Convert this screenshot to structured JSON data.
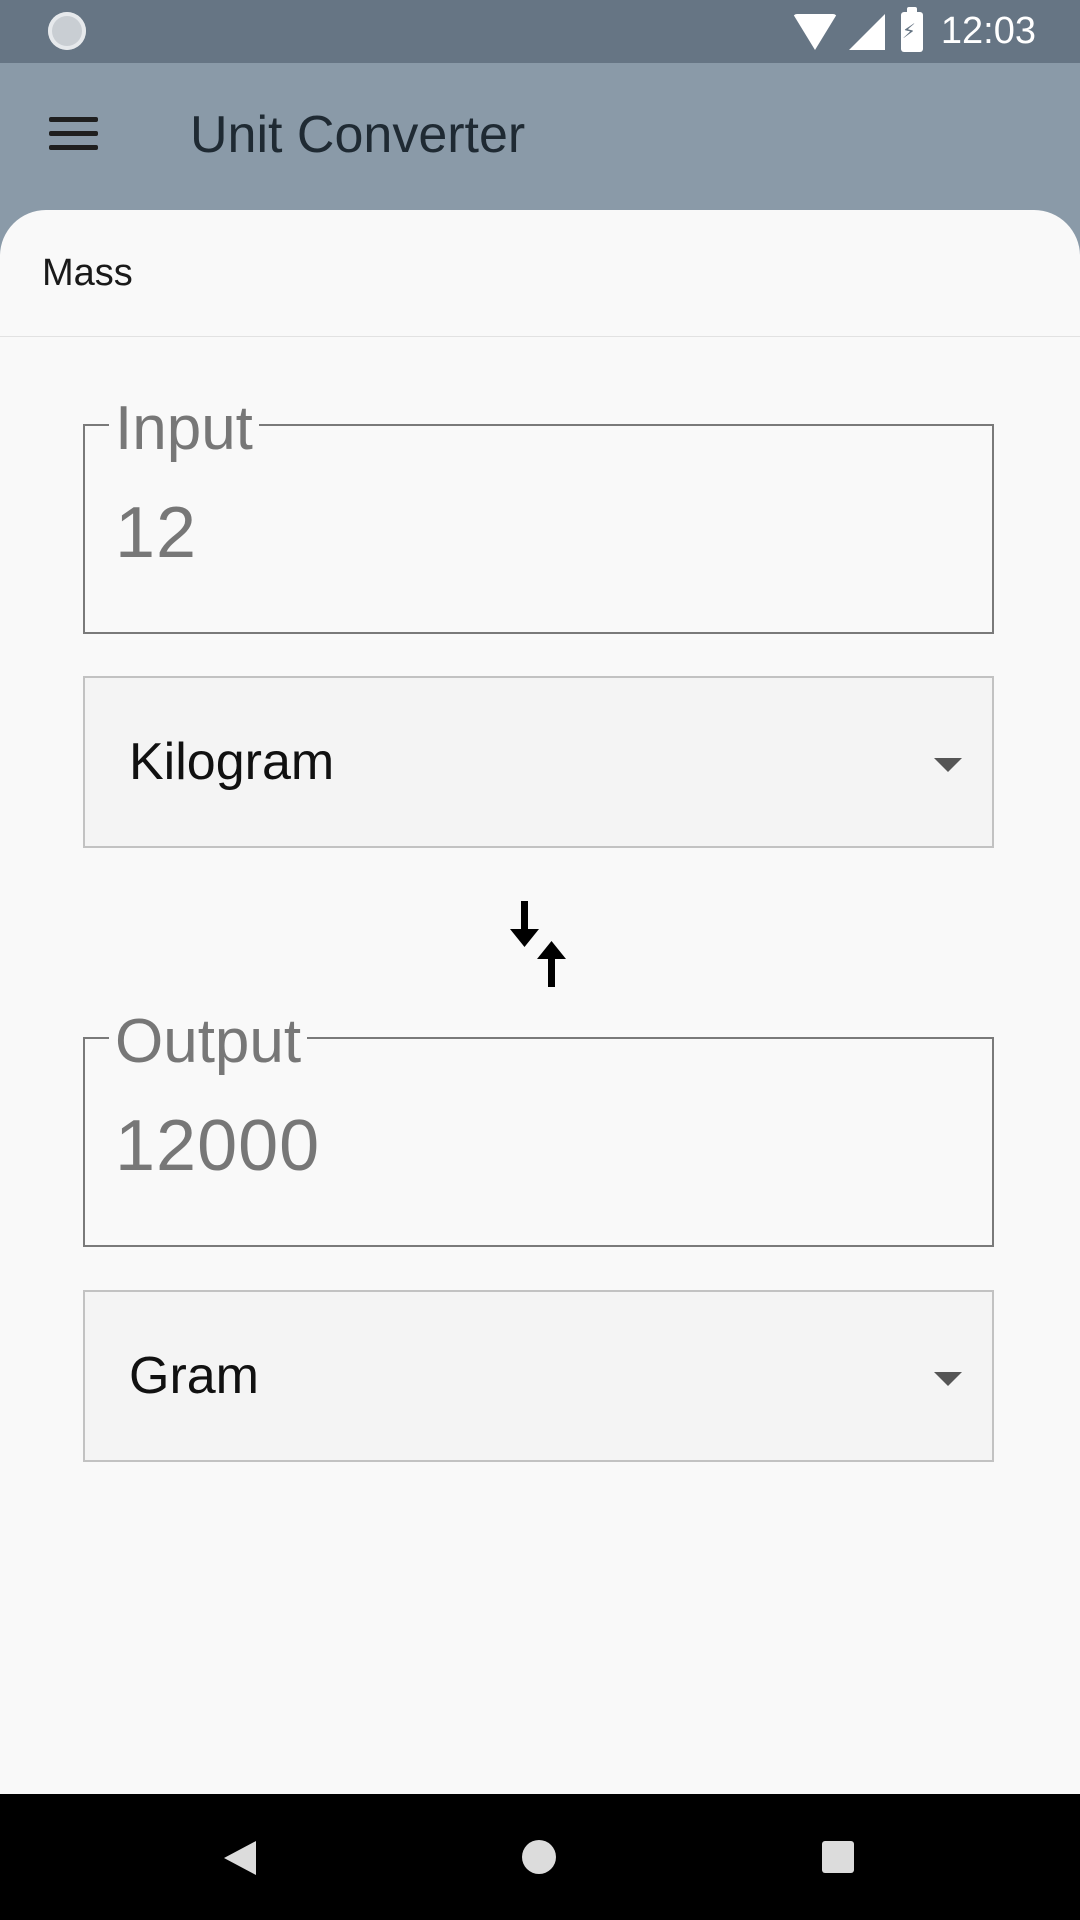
{
  "status_bar": {
    "time": "12:03"
  },
  "app_bar": {
    "title": "Unit Converter"
  },
  "tab": {
    "label": "Mass"
  },
  "input": {
    "label": "Input",
    "value": "12"
  },
  "input_unit": {
    "selected": "Kilogram"
  },
  "output": {
    "label": "Output",
    "value": "12000"
  },
  "output_unit": {
    "selected": "Gram"
  },
  "icons": {
    "menu": "menu-icon",
    "swap": "swap-arrows-icon",
    "dropdown": "chevron-down-icon",
    "nav_back": "back-icon",
    "nav_home": "home-icon",
    "nav_recents": "recents-icon"
  }
}
